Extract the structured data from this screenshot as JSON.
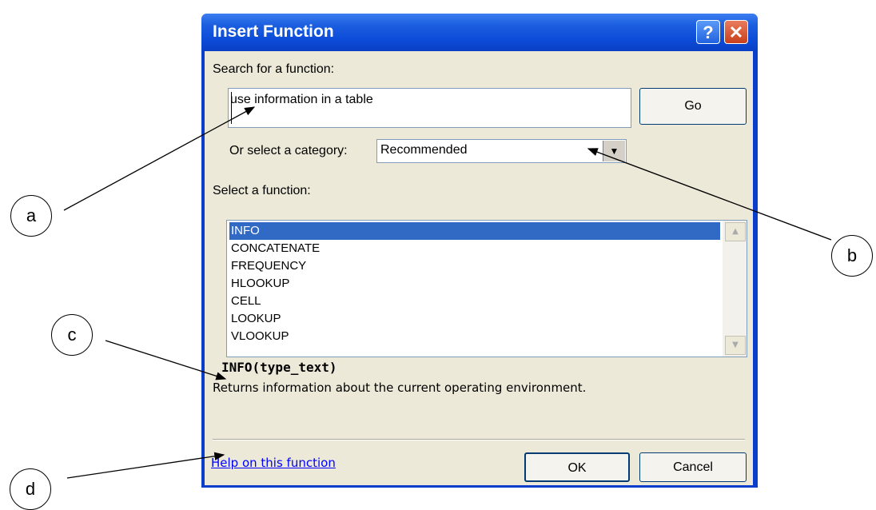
{
  "dialog": {
    "title": "Insert Function",
    "help_button": "?",
    "close_button": "✕"
  },
  "search": {
    "label": "Search for a function:",
    "value": "use information in a table",
    "go_label": "Go"
  },
  "category": {
    "label": "Or select a category:",
    "selected": "Recommended"
  },
  "functions": {
    "label": "Select a function:",
    "items": [
      "INFO",
      "CONCATENATE",
      "FREQUENCY",
      "HLOOKUP",
      "CELL",
      "LOOKUP",
      "VLOOKUP"
    ],
    "selected_index": 0
  },
  "details": {
    "signature": "INFO(type_text)",
    "description": "Returns information about the current operating environment."
  },
  "footer": {
    "help_link": "Help on this function",
    "ok_label": "OK",
    "cancel_label": "Cancel"
  },
  "callouts": [
    "a",
    "b",
    "c",
    "d"
  ]
}
